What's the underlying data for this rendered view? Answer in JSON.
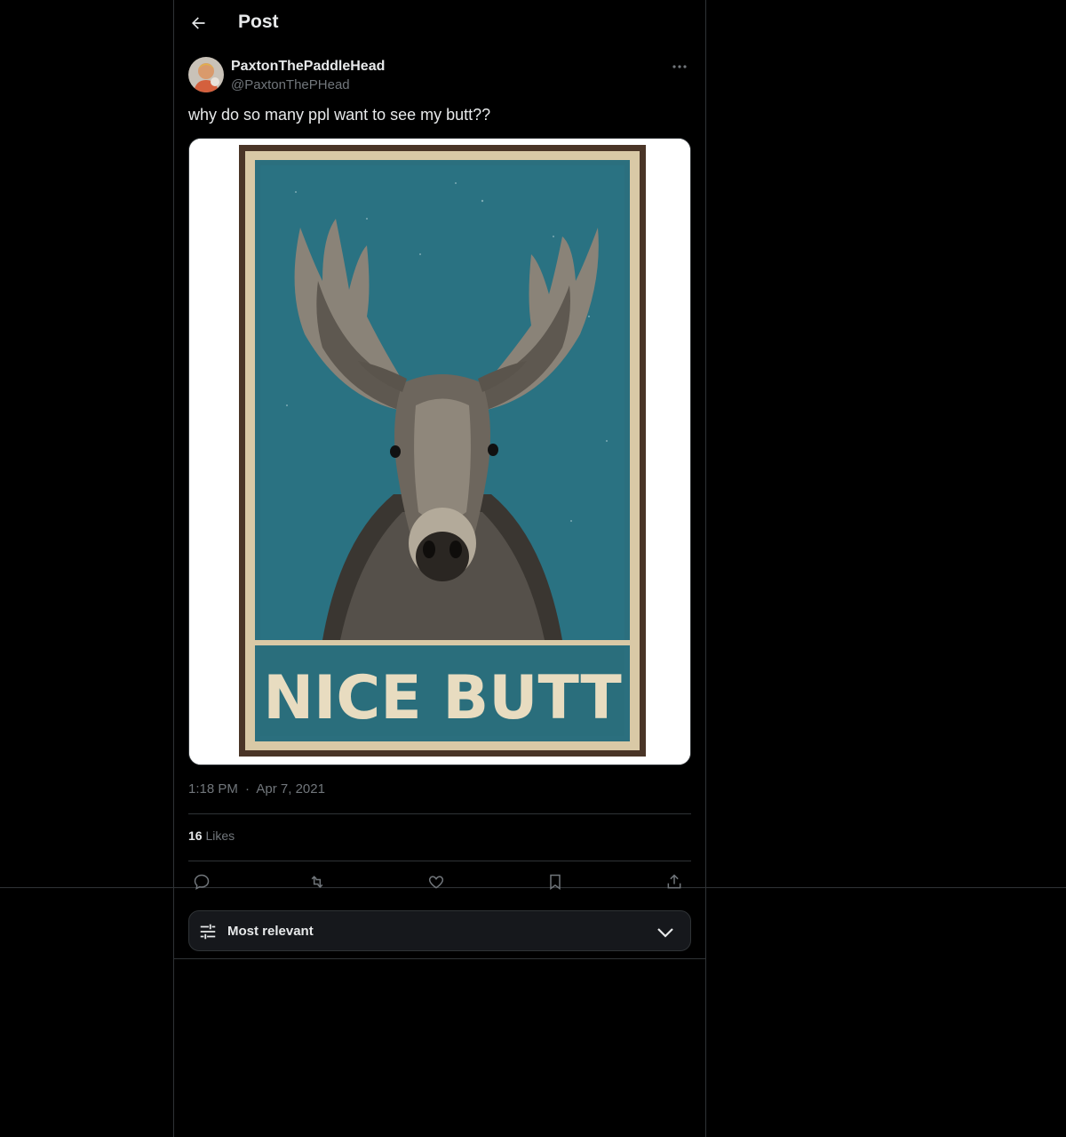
{
  "header": {
    "title": "Post"
  },
  "post": {
    "author": {
      "display_name": "PaxtonThePaddleHead",
      "handle": "@PaxtonThePHead"
    },
    "text": "why do so many ppl want to see my butt??",
    "image": {
      "caption_text": "NICE BUTT"
    },
    "time": "1:18 PM",
    "separator": "·",
    "date": "Apr 7, 2021",
    "likes_count": "16",
    "likes_label": "Likes"
  },
  "replies": {
    "sort_label": "Most relevant"
  },
  "icons": {
    "back": "back-arrow-icon",
    "more": "more-dots-icon",
    "reply": "reply-icon",
    "repost": "repost-icon",
    "like": "heart-icon",
    "bookmark": "bookmark-icon",
    "share": "share-icon",
    "sort": "sliders-icon",
    "chevron": "chevron-down-icon"
  },
  "colors": {
    "background": "#000000",
    "text_primary": "#e7e9ea",
    "text_secondary": "#71767b",
    "border": "#2f3336",
    "poster_teal": "#2b6f7e",
    "poster_cream": "#e8dcc0"
  }
}
